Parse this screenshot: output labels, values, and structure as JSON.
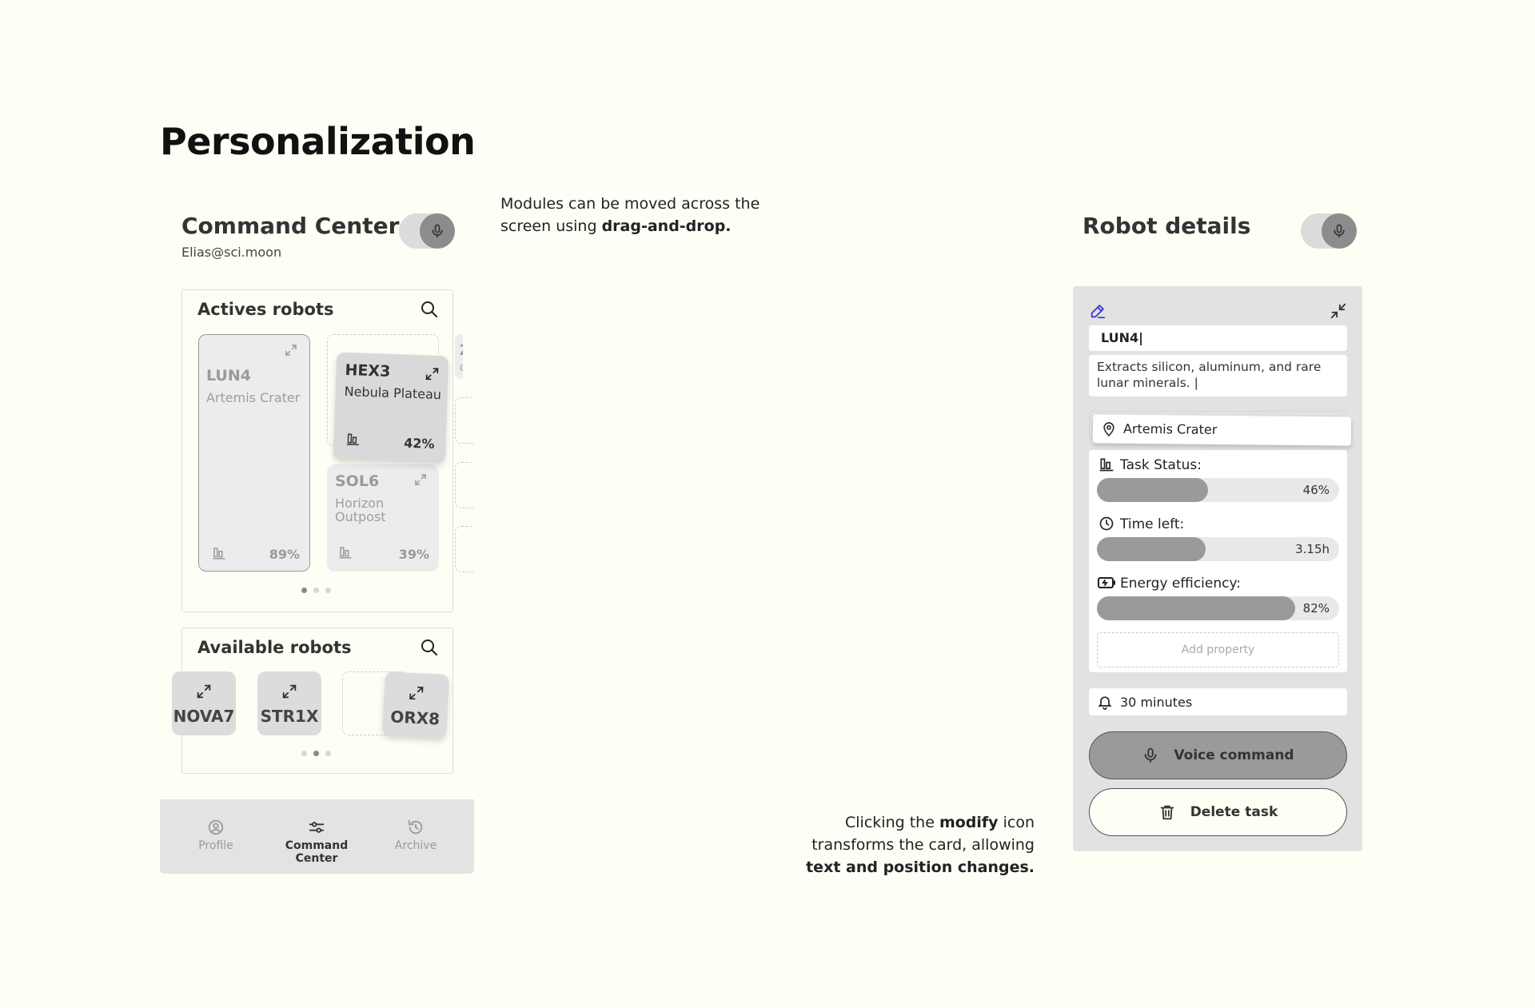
{
  "page": {
    "title": "Personalization"
  },
  "command_center": {
    "title": "Command Center",
    "email": "Elias@sci.moon",
    "active_panel": {
      "title": "Actives robots",
      "cards": [
        {
          "name": "LUN4",
          "location": "Artemis Crater",
          "percent": "89%"
        },
        {
          "name": "HEX3",
          "location": "Nebula Plateau",
          "percent": "42%"
        },
        {
          "name": "SOL6",
          "location_line1": "Horizon",
          "location_line2": "Outpost",
          "percent": "39%"
        },
        {
          "name": "Z",
          "location": "Ob"
        }
      ],
      "page_dots": {
        "count": 3,
        "active": 1
      }
    },
    "available_panel": {
      "title": "Available robots",
      "robots": [
        "NOVA7",
        "STR1X",
        "ORX8"
      ],
      "page_dots": {
        "count": 3,
        "active": 2
      }
    },
    "nav": [
      {
        "label": "Profile",
        "icon": "profile-icon",
        "active": false
      },
      {
        "label": "Command Center",
        "icon": "sliders-icon",
        "active": true
      },
      {
        "label": "Archive",
        "icon": "history-icon",
        "active": false
      }
    ]
  },
  "notes": {
    "drag": {
      "line1": "Modules can be moved across the",
      "line2_plain": "screen using ",
      "line2_bold": "drag-and-drop."
    },
    "modify": {
      "line1_plain": "Clicking the ",
      "line1_bold": "modify",
      "line1_end": " icon",
      "line2": "transforms the card, allowing",
      "line3_bold": "text and position changes."
    }
  },
  "robot_details": {
    "title": "Robot details",
    "name_value": "LUN4|",
    "description": "Extracts silicon, aluminum, and rare lunar minerals. |",
    "location": "Artemis Crater",
    "properties": [
      {
        "label": "Task Status:",
        "value": "46%",
        "fill": 0.46,
        "icon": "bar-chart-icon"
      },
      {
        "label": "Time left:",
        "value": "3.15h",
        "fill": 0.45,
        "icon": "clock-icon"
      },
      {
        "label": "Energy efficiency:",
        "value": "82%",
        "fill": 0.82,
        "icon": "battery-icon"
      }
    ],
    "add_property": "Add property",
    "reminder": "30 minutes",
    "voice_button": "Voice command",
    "delete_button": "Delete task",
    "accent": "#3b3bd6"
  }
}
